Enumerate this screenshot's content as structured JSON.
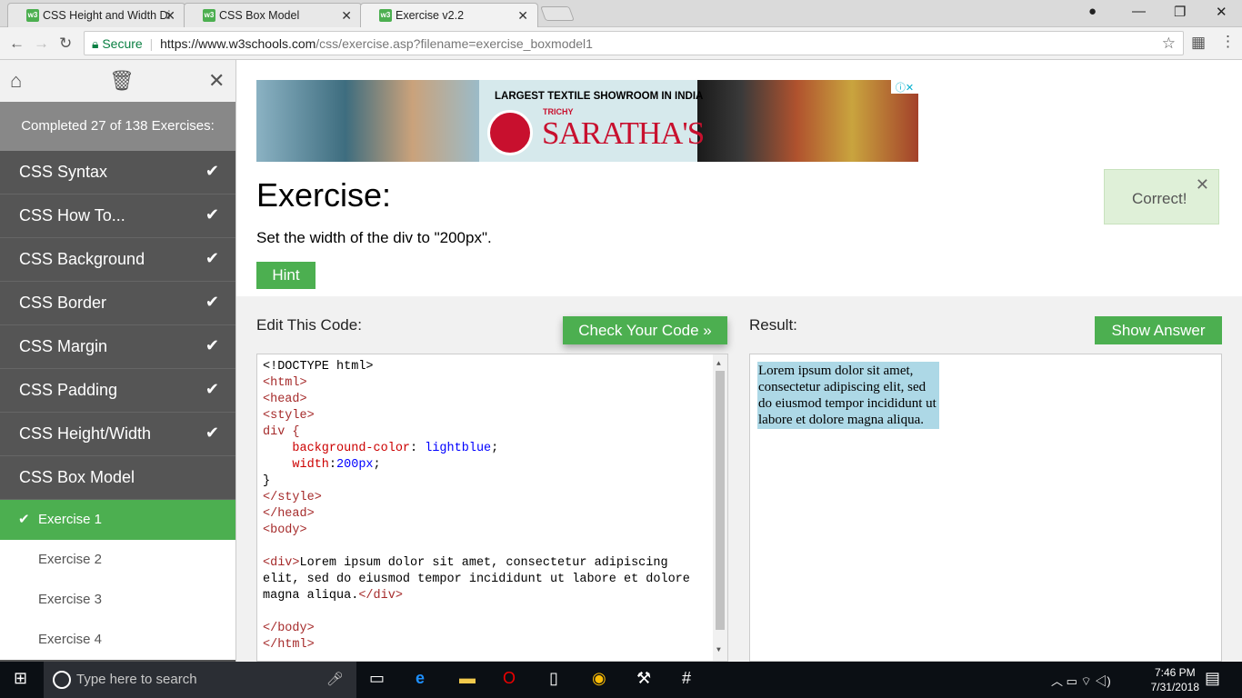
{
  "browser": {
    "tabs": [
      {
        "title": "CSS Height and Width Di",
        "icon": "w3"
      },
      {
        "title": "CSS Box Model",
        "icon": "w3"
      },
      {
        "title": "Exercise v2.2",
        "icon": "w3"
      }
    ],
    "secure_label": "Secure",
    "url_host": "https://www.w3schools.com",
    "url_path": "/css/exercise.asp?filename=exercise_boxmodel1"
  },
  "sidebar": {
    "completed": "Completed 27 of 138 Exercises:",
    "items": [
      {
        "label": "CSS Syntax"
      },
      {
        "label": "CSS How To..."
      },
      {
        "label": "CSS Background"
      },
      {
        "label": "CSS Border"
      },
      {
        "label": "CSS Margin"
      },
      {
        "label": "CSS Padding"
      },
      {
        "label": "CSS Height/Width"
      },
      {
        "label": "CSS Box Model"
      }
    ],
    "subitems": [
      {
        "label": "Exercise 1"
      },
      {
        "label": "Exercise 2"
      },
      {
        "label": "Exercise 3"
      },
      {
        "label": "Exercise 4"
      }
    ]
  },
  "ad": {
    "line1": "LARGEST TEXTILE SHOWROOM IN INDIA",
    "city": "TRICHY",
    "brand": "SARATHA'S"
  },
  "exercise": {
    "title": "Exercise:",
    "instruction": "Set the width of the div to \"200px\".",
    "hint": "Hint",
    "correct": "Correct!",
    "edit_label": "Edit This Code:",
    "check_button": "Check Your Code »",
    "result_label": "Result:",
    "show_answer": "Show Answer",
    "result_text": "Lorem ipsum dolor sit amet, consectetur adipiscing elit, sed do eiusmod tempor incididunt ut labore et dolore magna aliqua."
  },
  "code": {
    "doctype": "<!DOCTYPE html>",
    "html_open": "<html>",
    "head_open": "<head>",
    "style_open": "<style>",
    "selector": "div {",
    "prop1": "background-color",
    "val1": "lightblue",
    "prop2": "width",
    "val2": "200px",
    "close_brace": "}",
    "style_close": "</style>",
    "head_close": "</head>",
    "body_open": "<body>",
    "div_open": "<div>",
    "div_text1": "Lorem ipsum dolor sit amet, consectetur adipiscing",
    "div_text2": "elit, sed do eiusmod tempor incididunt ut labore et dolore",
    "div_text3": "magna aliqua.",
    "div_close": "</div>",
    "body_close": "</body>",
    "html_close": "</html>"
  },
  "taskbar": {
    "search_placeholder": "Type here to search",
    "time": "7:46 PM",
    "date": "7/31/2018"
  }
}
